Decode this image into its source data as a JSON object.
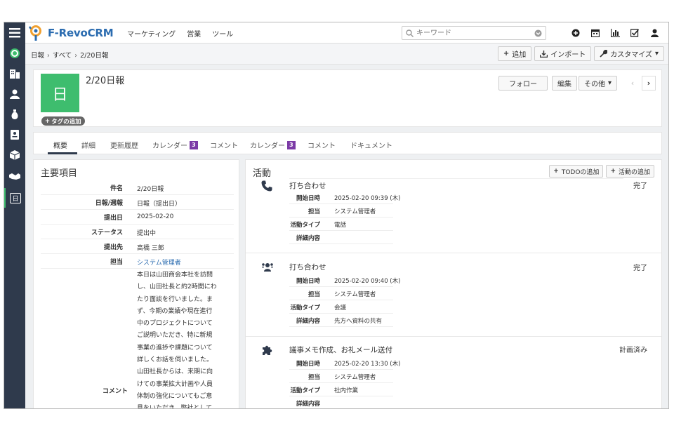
{
  "brand": {
    "name_prefix": "F-Revo",
    "name_suffix": "CRM"
  },
  "topnav": [
    "マーケティング",
    "営業",
    "ツール"
  ],
  "search": {
    "placeholder": "キーワード"
  },
  "breadcrumb": [
    "日報",
    "すべて",
    "2/20日報"
  ],
  "header_buttons": {
    "add": "追加",
    "import": "インポート",
    "customize": "カスタマイズ"
  },
  "record": {
    "icon_letter": "日",
    "title": "2/20日報",
    "tag_button": "タグの追加",
    "follow": "フォロー",
    "edit": "編集",
    "more": "その他",
    "prev": "‹",
    "next": "›"
  },
  "tabs": [
    {
      "label": "概要"
    },
    {
      "label": "詳細"
    },
    {
      "label": "更新履歴"
    },
    {
      "label": "カレンダー",
      "badge": "3"
    },
    {
      "label": "コメント"
    },
    {
      "label": "カレンダー",
      "badge": "3"
    },
    {
      "label": "コメント"
    },
    {
      "label": "ドキュメント"
    }
  ],
  "summary": {
    "title": "主要項目",
    "fields": [
      {
        "label": "件名",
        "value": "2/20日報"
      },
      {
        "label": "日報/週報",
        "value": "日報（提出日）"
      },
      {
        "label": "提出日",
        "value": "2025-02-20"
      },
      {
        "label": "ステータス",
        "value": "提出中"
      },
      {
        "label": "提出先",
        "value": "高橋 三郎"
      },
      {
        "label": "担当",
        "value": "システム管理者"
      }
    ],
    "comment_label": "コメント",
    "comment_lines": [
      "本日は山田商会本社を訪問",
      "し、山田社長と約2時間にわ",
      "たり面談を行いました。ま",
      "ず、今期の業績や現在進行",
      "中のプロジェクトについて",
      "ご説明いただき、特に新規",
      "事業の進捗や課題について",
      "詳しくお話を伺いました。",
      "山田社長からは、来期に向",
      "けての事業拡大計画や人員",
      "体制の強化についてもご意",
      "見をいただき、弊社として"
    ]
  },
  "activities": {
    "title": "活動",
    "add_todo": "TODOの追加",
    "add_activity": "活動の追加",
    "labels": {
      "start": "開始日時",
      "owner": "担当",
      "type": "活動タイプ",
      "detail": "詳細内容"
    },
    "items": [
      {
        "icon": "phone-icon",
        "title": "打ち合わせ",
        "status": "完了",
        "start": "2025-02-20 09:39 (木)",
        "owner": "システム管理者",
        "type": "電話",
        "detail": ""
      },
      {
        "icon": "meeting-icon",
        "title": "打ち合わせ",
        "status": "完了",
        "start": "2025-02-20 09:40 (木)",
        "owner": "システム管理者",
        "type": "会議",
        "detail": "先方へ資料の共有"
      },
      {
        "icon": "puzzle-icon",
        "title": "議事メモ作成、お礼メール送付",
        "status": "計画済み",
        "start": "2025-02-20 13:30 (木)",
        "owner": "システム管理者",
        "type": "社内作業",
        "detail": ""
      }
    ]
  },
  "colors": {
    "sidebar": "#2f3a4c",
    "record_icon": "#3ebd6e",
    "badge": "#7b3aa6",
    "link": "#2b6cb0"
  }
}
